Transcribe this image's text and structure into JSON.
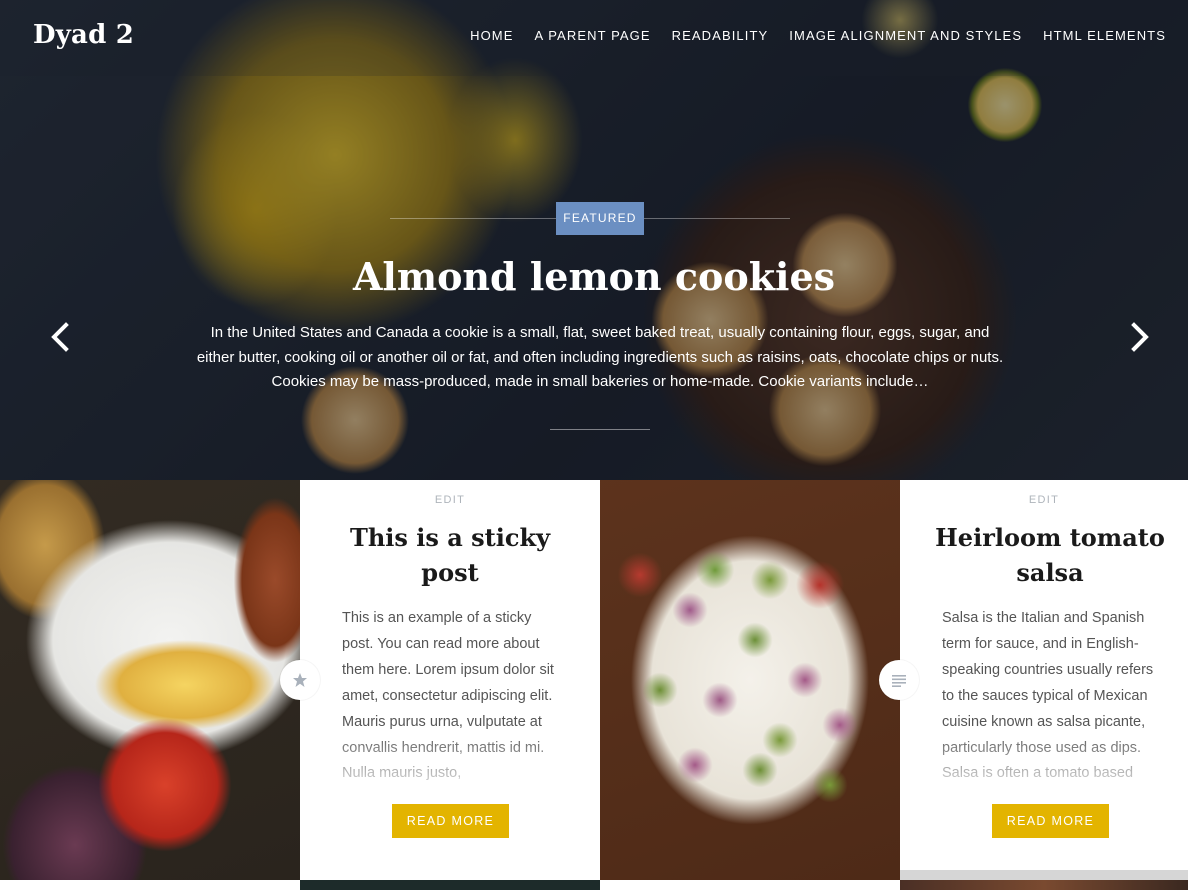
{
  "site": {
    "title": "Dyad 2"
  },
  "nav": [
    {
      "label": "HOME"
    },
    {
      "label": "A PARENT PAGE"
    },
    {
      "label": "READABILITY"
    },
    {
      "label": "IMAGE ALIGNMENT AND STYLES"
    },
    {
      "label": "HTML ELEMENTS"
    }
  ],
  "hero": {
    "badge": "FEATURED",
    "title": "Almond lemon cookies",
    "excerpt": "In the United States and Canada a cookie is a small, flat, sweet baked treat, usually containing flour, eggs, sugar, and either butter, cooking oil or another oil or fat, and often including ingredients such as raisins, oats, chocolate chips or nuts. Cookies may be mass-produced, made in small bakeries or home-made. Cookie variants include…",
    "prev_icon": "chevron-left-icon",
    "next_icon": "chevron-right-icon"
  },
  "posts": [
    {
      "edit": "EDIT",
      "title": "This is a sticky post",
      "excerpt": "This is an example of a sticky post. You can read more about them here. Lorem ipsum dolor sit amet, consectetur adipiscing elit. Mauris purus urna, vulputate at convallis hendrerit, mattis id mi. Nulla mauris justo,",
      "read_more": "READ MORE",
      "format_icon": "star-icon"
    },
    {
      "edit": "EDIT",
      "title": "Heirloom tomato salsa",
      "excerpt": "Salsa is the Italian and Spanish term for sauce, and in English-speaking countries usually refers to the sauces typical of Mexican cuisine known as salsa picante, particularly those used as dips. Salsa is often a tomato based",
      "read_more": "READ MORE",
      "format_icon": "text-lines-icon"
    }
  ],
  "colors": {
    "featured_badge": "#6b8fc2",
    "read_more": "#e3b400",
    "edit_link": "#aeb4bb"
  }
}
